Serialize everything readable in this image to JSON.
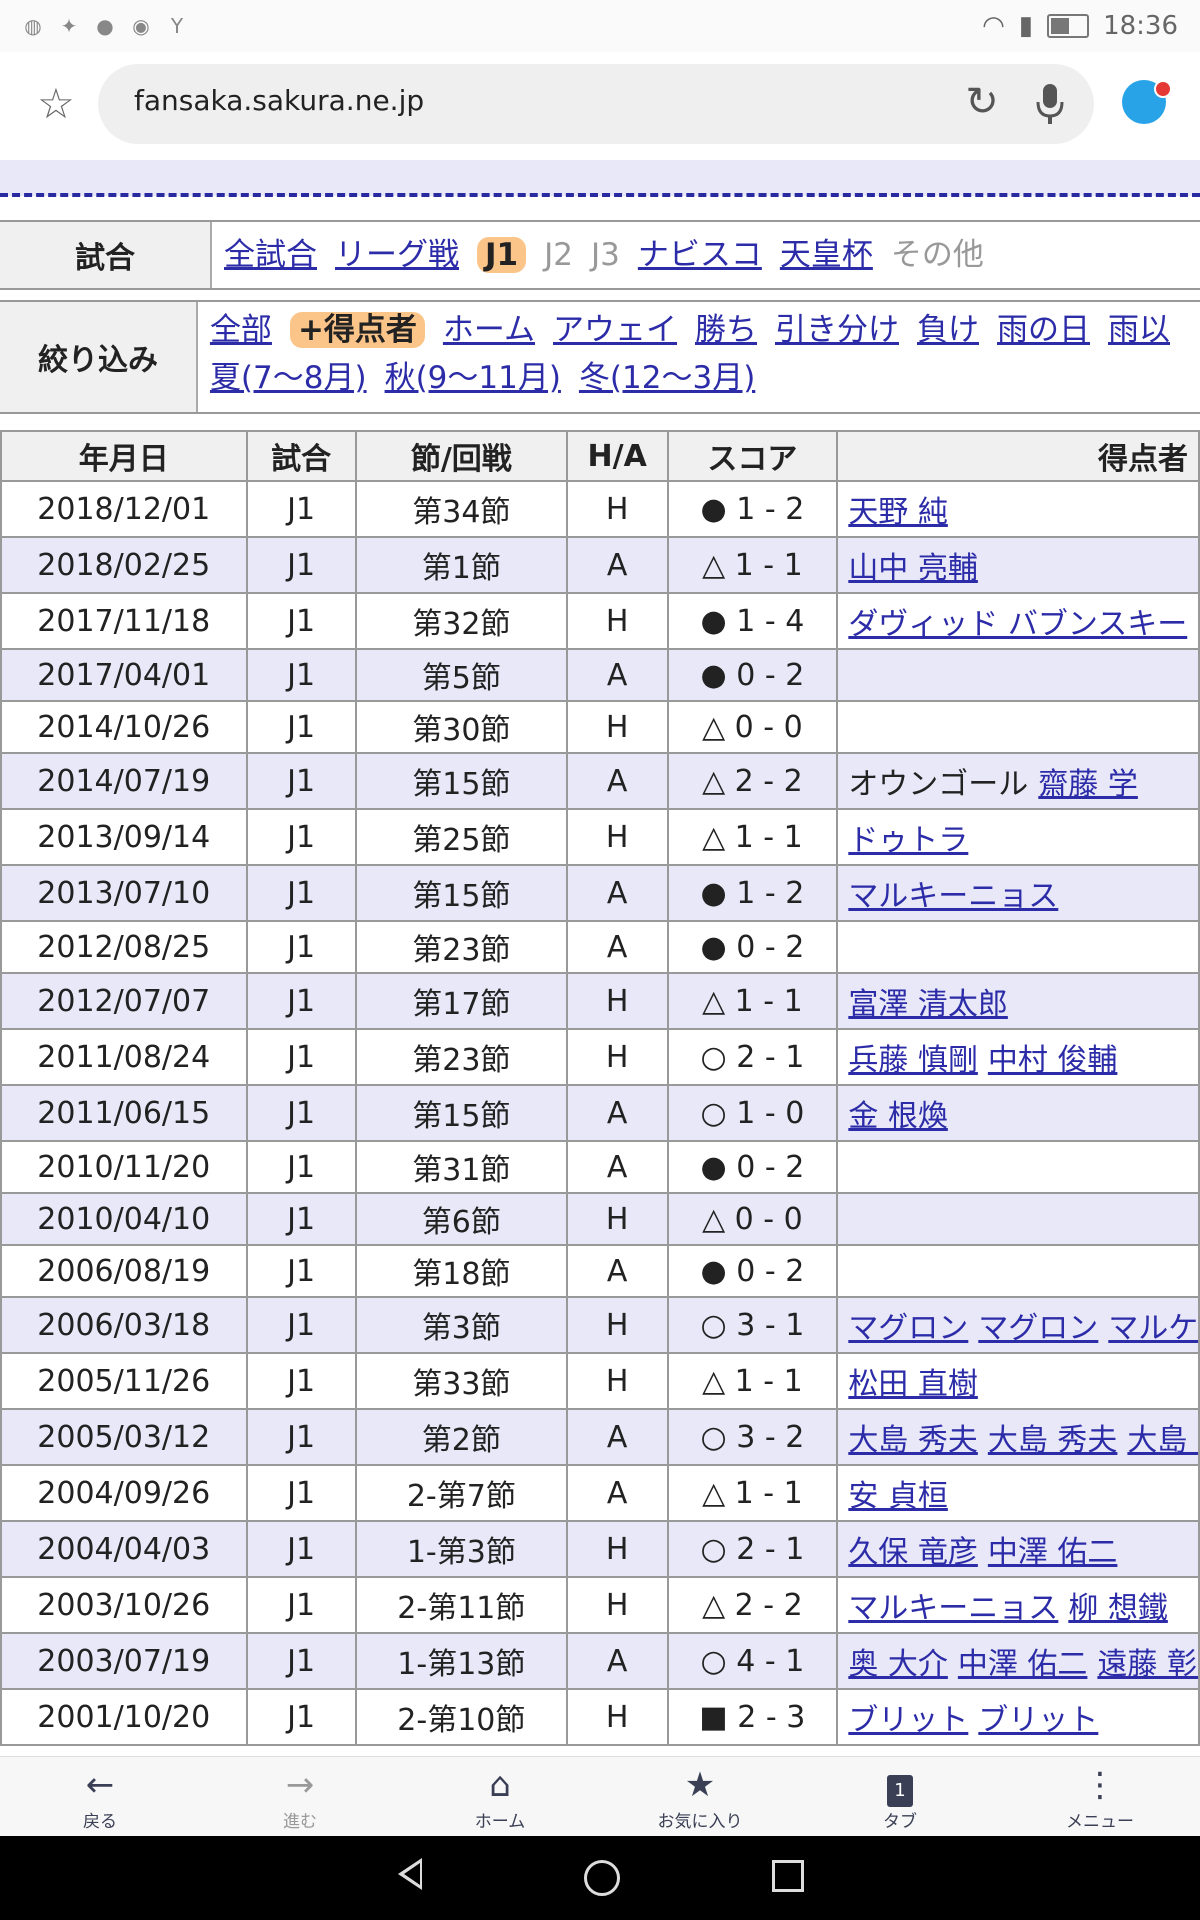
{
  "status": {
    "time": "18:36"
  },
  "browser": {
    "url": "fansaka.sakura.ne.jp"
  },
  "filters": {
    "match": {
      "label": "試合",
      "items": [
        {
          "text": "全試合",
          "state": "link"
        },
        {
          "text": "リーグ戦",
          "state": "link"
        },
        {
          "text": "J1",
          "state": "selected"
        },
        {
          "text": "J2",
          "state": "disabled"
        },
        {
          "text": "J3",
          "state": "disabled"
        },
        {
          "text": "ナビスコ",
          "state": "link"
        },
        {
          "text": "天皇杯",
          "state": "link"
        },
        {
          "text": "その他",
          "state": "disabled"
        }
      ]
    },
    "narrow": {
      "label": "絞り込み",
      "line1": [
        {
          "text": "全部",
          "state": "link"
        },
        {
          "text": "+得点者",
          "state": "selected"
        },
        {
          "text": "ホーム",
          "state": "link"
        },
        {
          "text": "アウェイ",
          "state": "link"
        },
        {
          "text": "勝ち",
          "state": "link"
        },
        {
          "text": "引き分け",
          "state": "link"
        },
        {
          "text": "負け",
          "state": "link"
        },
        {
          "text": "雨の日",
          "state": "link"
        },
        {
          "text": "雨以",
          "state": "link"
        }
      ],
      "line2": [
        {
          "text": "夏(7〜8月)",
          "state": "link"
        },
        {
          "text": "秋(9〜11月)",
          "state": "link"
        },
        {
          "text": "冬(12〜3月)",
          "state": "link"
        }
      ]
    }
  },
  "table": {
    "headers": [
      "年月日",
      "試合",
      "節/回戦",
      "H/A",
      "スコア",
      "得点者"
    ],
    "rows": [
      {
        "date": "2018/12/01",
        "match": "J1",
        "round": "第34節",
        "ha": "H",
        "score": "● 1 - 2",
        "scorers": [
          "天野 純"
        ]
      },
      {
        "date": "2018/02/25",
        "match": "J1",
        "round": "第1節",
        "ha": "A",
        "score": "△ 1 - 1",
        "scorers": [
          "山中 亮輔"
        ]
      },
      {
        "date": "2017/11/18",
        "match": "J1",
        "round": "第32節",
        "ha": "H",
        "score": "● 1 - 4",
        "scorers": [
          "ダヴィッド バブンスキー"
        ]
      },
      {
        "date": "2017/04/01",
        "match": "J1",
        "round": "第5節",
        "ha": "A",
        "score": "● 0 - 2",
        "scorers": []
      },
      {
        "date": "2014/10/26",
        "match": "J1",
        "round": "第30節",
        "ha": "H",
        "score": "△ 0 - 0",
        "scorers": []
      },
      {
        "date": "2014/07/19",
        "match": "J1",
        "round": "第15節",
        "ha": "A",
        "score": "△ 2 - 2",
        "og": "オウンゴール",
        "scorers": [
          "齋藤 学"
        ]
      },
      {
        "date": "2013/09/14",
        "match": "J1",
        "round": "第25節",
        "ha": "H",
        "score": "△ 1 - 1",
        "scorers": [
          "ドゥトラ"
        ]
      },
      {
        "date": "2013/07/10",
        "match": "J1",
        "round": "第15節",
        "ha": "A",
        "score": "● 1 - 2",
        "scorers": [
          "マルキーニョス"
        ]
      },
      {
        "date": "2012/08/25",
        "match": "J1",
        "round": "第23節",
        "ha": "A",
        "score": "● 0 - 2",
        "scorers": []
      },
      {
        "date": "2012/07/07",
        "match": "J1",
        "round": "第17節",
        "ha": "H",
        "score": "△ 1 - 1",
        "scorers": [
          "富澤 清太郎"
        ]
      },
      {
        "date": "2011/08/24",
        "match": "J1",
        "round": "第23節",
        "ha": "H",
        "score": "○ 2 - 1",
        "scorers": [
          "兵藤 慎剛",
          "中村 俊輔"
        ]
      },
      {
        "date": "2011/06/15",
        "match": "J1",
        "round": "第15節",
        "ha": "A",
        "score": "○ 1 - 0",
        "scorers": [
          "金 根煥"
        ]
      },
      {
        "date": "2010/11/20",
        "match": "J1",
        "round": "第31節",
        "ha": "A",
        "score": "● 0 - 2",
        "scorers": []
      },
      {
        "date": "2010/04/10",
        "match": "J1",
        "round": "第6節",
        "ha": "H",
        "score": "△ 0 - 0",
        "scorers": []
      },
      {
        "date": "2006/08/19",
        "match": "J1",
        "round": "第18節",
        "ha": "A",
        "score": "● 0 - 2",
        "scorers": []
      },
      {
        "date": "2006/03/18",
        "match": "J1",
        "round": "第3節",
        "ha": "H",
        "score": "○ 3 - 1",
        "scorers": [
          "マグロン",
          "マグロン",
          "マルケ"
        ]
      },
      {
        "date": "2005/11/26",
        "match": "J1",
        "round": "第33節",
        "ha": "H",
        "score": "△ 1 - 1",
        "scorers": [
          "松田 直樹"
        ]
      },
      {
        "date": "2005/03/12",
        "match": "J1",
        "round": "第2節",
        "ha": "A",
        "score": "○ 3 - 2",
        "scorers": [
          "大島 秀夫",
          "大島 秀夫",
          "大島 秀"
        ]
      },
      {
        "date": "2004/09/26",
        "match": "J1",
        "round": "2-第7節",
        "ha": "A",
        "score": "△ 1 - 1",
        "scorers": [
          "安 貞桓"
        ]
      },
      {
        "date": "2004/04/03",
        "match": "J1",
        "round": "1-第3節",
        "ha": "H",
        "score": "○ 2 - 1",
        "scorers": [
          "久保 竜彦",
          "中澤 佑二"
        ]
      },
      {
        "date": "2003/10/26",
        "match": "J1",
        "round": "2-第11節",
        "ha": "H",
        "score": "△ 2 - 2",
        "scorers": [
          "マルキーニョス",
          "柳 想鐵"
        ]
      },
      {
        "date": "2003/07/19",
        "match": "J1",
        "round": "1-第13節",
        "ha": "A",
        "score": "○ 4 - 1",
        "scorers": [
          "奥 大介",
          "中澤 佑二",
          "遠藤 彰弘"
        ]
      },
      {
        "date": "2001/10/20",
        "match": "J1",
        "round": "2-第10節",
        "ha": "H",
        "score": "■ 2 - 3",
        "scorers": [
          "ブリット",
          "ブリット"
        ]
      }
    ]
  },
  "bottom_nav": [
    {
      "label": "戻る",
      "icon": "arrow-left-icon",
      "glyph": "←",
      "enabled": true
    },
    {
      "label": "進む",
      "icon": "arrow-right-icon",
      "glyph": "→",
      "enabled": false
    },
    {
      "label": "ホーム",
      "icon": "home-icon",
      "glyph": "⌂",
      "enabled": true
    },
    {
      "label": "お気に入り",
      "icon": "bookmark-star-icon",
      "glyph": "★",
      "enabled": true
    },
    {
      "label": "タブ",
      "icon": "tab-count-icon",
      "glyph": "1",
      "enabled": true
    },
    {
      "label": "メニュー",
      "icon": "more-vert-icon",
      "glyph": "⋮",
      "enabled": true
    }
  ]
}
